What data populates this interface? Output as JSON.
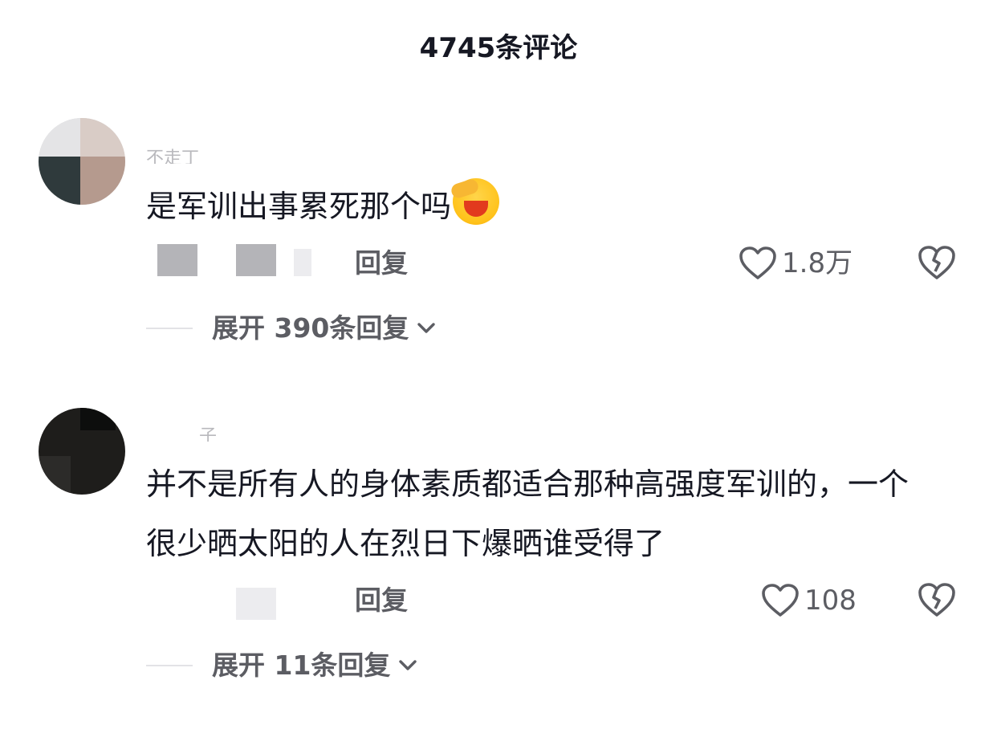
{
  "header": {
    "title": "4745条评论"
  },
  "comments": [
    {
      "username": "不走丁",
      "text": "是军训出事累死那个吗",
      "reply_label": "回复",
      "like_count": "1.8万",
      "expand_label": "展开 390条回复"
    },
    {
      "username": "　　　子",
      "text": "并不是所有人的身体素质都适合那种高强度军训的，一个很少晒太阳的人在烈日下爆晒谁受得了",
      "reply_label": "回复",
      "like_count": "108",
      "expand_label": "展开 11条回复"
    }
  ],
  "icons": {
    "like": "heart-outline-icon",
    "dislike": "broken-heart-icon",
    "expand": "chevron-down-icon",
    "emoji": "crying-laughing-emoji"
  },
  "colors": {
    "text": "#161823",
    "secondary": "#5c5d63",
    "muted": "#b9b9bd"
  }
}
